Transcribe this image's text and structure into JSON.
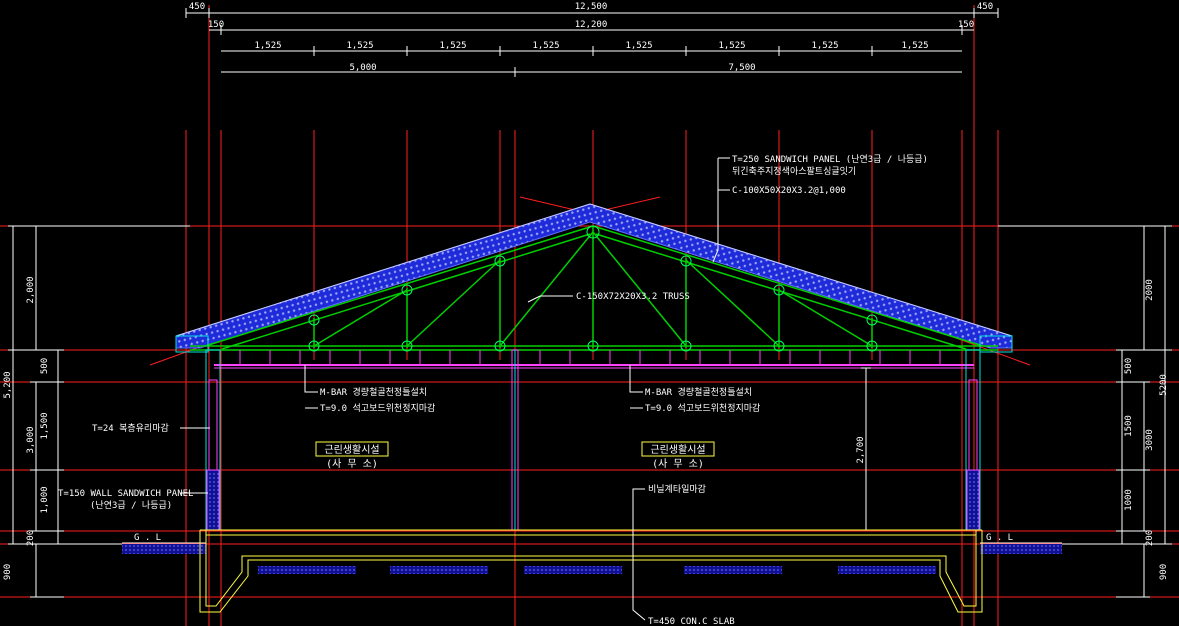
{
  "dimensions": {
    "top_overall": {
      "left": "450",
      "center": "12,500",
      "right": "450"
    },
    "top_span": {
      "left": "150",
      "center": "12,200",
      "right": "150"
    },
    "bays": [
      "1,525",
      "1,525",
      "1,525",
      "1,525",
      "1,525",
      "1,525",
      "1,525",
      "1,525"
    ],
    "rooms": {
      "left": "5,000",
      "right": "7,500"
    },
    "left_side": {
      "total": "5,200",
      "upper": "2,000",
      "wall": "3,000",
      "d500": "500",
      "d1500": "1,500",
      "d1000": "1,000",
      "d200": "200",
      "d900": "900"
    },
    "right_side": {
      "total": "5200",
      "upper": "2000",
      "wall": "3000",
      "d500": "500",
      "d1500": "1500",
      "d1000": "1000",
      "d200": "200",
      "d900": "900"
    },
    "ceiling_height": "2,700"
  },
  "notes": {
    "roof_panel": "T=250 SANDWICH PANEL  (난연3급 / 나등급)",
    "roof_panel_sub": "뒤긴축주지정색아스팔트싱글잇기",
    "purlin": "C-100X50X20X3.2@1,000",
    "truss": "C-150X72X20X3.2 TRUSS",
    "ceiling_left_1": "M-BAR 경량철골천정틀설치",
    "ceiling_left_2": "T=9.0 석고보드위천정지마감",
    "ceiling_right_1": "M-BAR 경량철골천정틀설치",
    "ceiling_right_2": "T=9.0 석고보드위천정지마감",
    "glass": "T=24 복층유리마감",
    "wall_panel": "T=150 WALL SANDWICH PANEL",
    "wall_panel_sub": "(난연3급 / 나등급)",
    "floor": "비닐계타일마감",
    "slab": "T=450 CON.C SLAB",
    "gl_left": "G . L",
    "gl_right": "G . L"
  },
  "rooms": [
    {
      "name": "근린생활시설",
      "use": "(사 무 소)"
    },
    {
      "name": "근린생활시설",
      "use": "(사 무 소)"
    }
  ],
  "colors": {
    "background": "#000000",
    "roof_panel": "#2b3bff",
    "truss": "#00d000",
    "grid": "#ff1e1e",
    "ceiling": "#ff40ff",
    "dimension": "#ffffff",
    "slab": "#ffff40",
    "column": "#00ffff"
  }
}
